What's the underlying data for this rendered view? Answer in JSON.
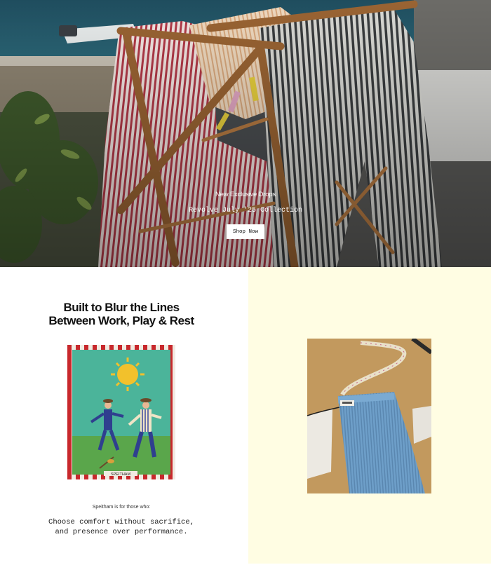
{
  "hero": {
    "eyebrow": "New Exclusive Drops",
    "subtitle": "Revolve July '25 Collection",
    "cta_label": "Shop Now"
  },
  "story": {
    "title_line1": "Built to Blur the Lines",
    "title_line2": "Between Work, Play & Rest",
    "card_brand": "SPEITHAM",
    "kicker": "Speitham is for those who:",
    "statement_line1": "Choose comfort without sacrifice,",
    "statement_line2": "and presence over performance."
  },
  "colors": {
    "right_panel_bg": "#fffde3",
    "cta_bg": "#ffffff"
  }
}
